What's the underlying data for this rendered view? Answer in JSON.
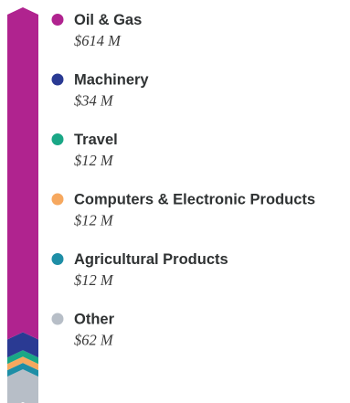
{
  "chart_data": {
    "type": "stacked-bar",
    "unit": "$ M",
    "series": [
      {
        "name": "Oil & Gas",
        "value": 614,
        "value_label": "$614 M",
        "color": "#b0238f"
      },
      {
        "name": "Machinery",
        "value": 34,
        "value_label": "$34 M",
        "color": "#2a3a93"
      },
      {
        "name": "Travel",
        "value": 12,
        "value_label": "$12 M",
        "color": "#1aa786"
      },
      {
        "name": "Computers & Electronic Products",
        "value": 12,
        "value_label": "$12 M",
        "color": "#f6a85f"
      },
      {
        "name": "Agricultural Products",
        "value": 12,
        "value_label": "$12 M",
        "color": "#1e8ea6"
      },
      {
        "name": "Other",
        "value": 62,
        "value_label": "$62 M",
        "color": "#b7bec7"
      }
    ]
  }
}
